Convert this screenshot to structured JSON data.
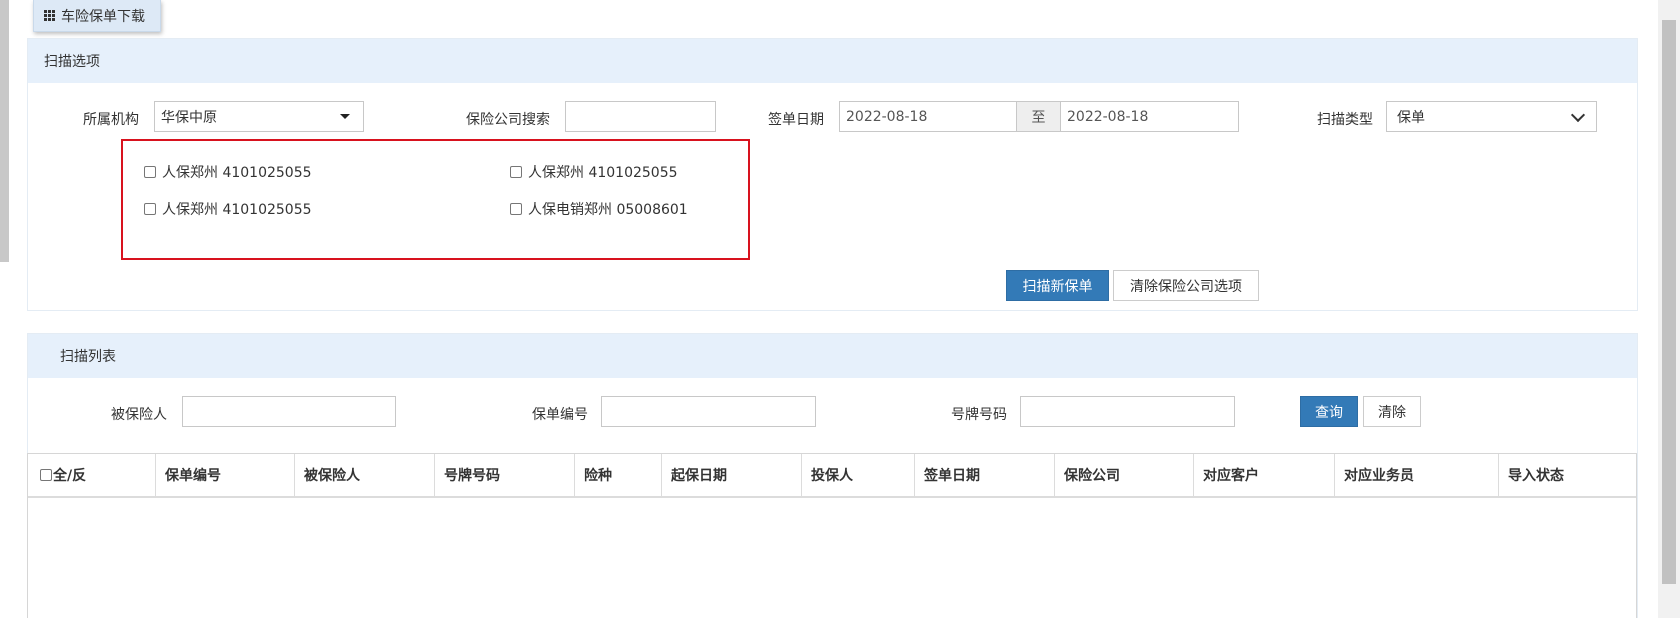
{
  "title_tab": {
    "label": "车险保单下载",
    "icon": "grid-icon"
  },
  "scan_options": {
    "header": "扫描选项",
    "org_label": "所属机构",
    "org_value": "华保中原",
    "insurer_search_label": "保险公司搜索",
    "insurer_search_value": "",
    "sign_date_label": "签单日期",
    "date_from": "2022-08-18",
    "date_sep": "至",
    "date_to": "2022-08-18",
    "scan_type_label": "扫描类型",
    "scan_type_value": "保单",
    "companies": [
      {
        "label": "人保郑州 4101025055",
        "checked": false
      },
      {
        "label": "人保郑州 4101025055",
        "checked": false
      },
      {
        "label": "人保郑州 4101025055",
        "checked": false
      },
      {
        "label": "人保电销郑州 05008601",
        "checked": false
      }
    ],
    "scan_button": "扫描新保单",
    "clear_button": "清除保险公司选项"
  },
  "scan_list": {
    "header": "扫描列表",
    "insured_label": "被保险人",
    "insured_value": "",
    "policy_no_label": "保单编号",
    "policy_no_value": "",
    "plate_label": "号牌号码",
    "plate_value": "",
    "query_button": "查询",
    "clear_button": "清除",
    "select_all_label": "全/反",
    "columns": [
      "保单编号",
      "被保险人",
      "号牌号码",
      "险种",
      "起保日期",
      "投保人",
      "签单日期",
      "保险公司",
      "对应客户",
      "对应业务员",
      "导入状态"
    ],
    "rows": []
  },
  "colors": {
    "primary": "#337ab7",
    "panel_header": "#e6f0fb",
    "highlight": "#d8121e"
  }
}
